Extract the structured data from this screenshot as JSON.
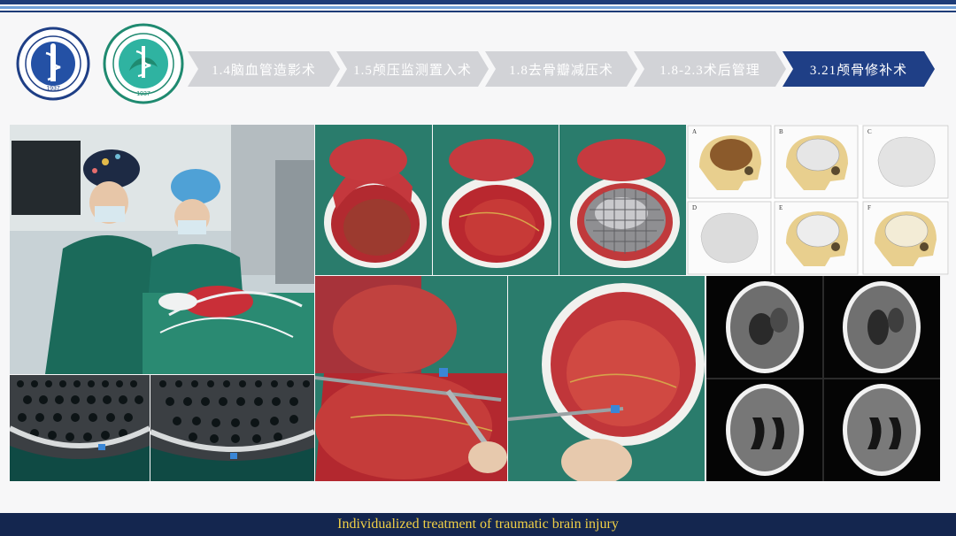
{
  "header": {
    "breadcrumb": [
      {
        "label": "1.4脑血管造影术",
        "active": false
      },
      {
        "label": "1.5颅压监测置入术",
        "active": false
      },
      {
        "label": "1.8去骨瓣减压术",
        "active": false
      },
      {
        "label": "1.8-2.3术后管理",
        "active": false
      },
      {
        "label": "3.21颅骨修补术",
        "active": true
      }
    ]
  },
  "logos": {
    "left_year": "1937",
    "right_year": "1937"
  },
  "figure": {
    "schematic_labels": [
      "A",
      "B",
      "C",
      "D",
      "E",
      "F"
    ]
  },
  "footer": {
    "caption": "Individualized treatment of traumatic brain injury"
  },
  "colors": {
    "brand_navy": "#1f3f86",
    "crumb_inactive": "#d2d3d7",
    "footer_bg": "#14264f",
    "footer_text": "#f1d046"
  }
}
